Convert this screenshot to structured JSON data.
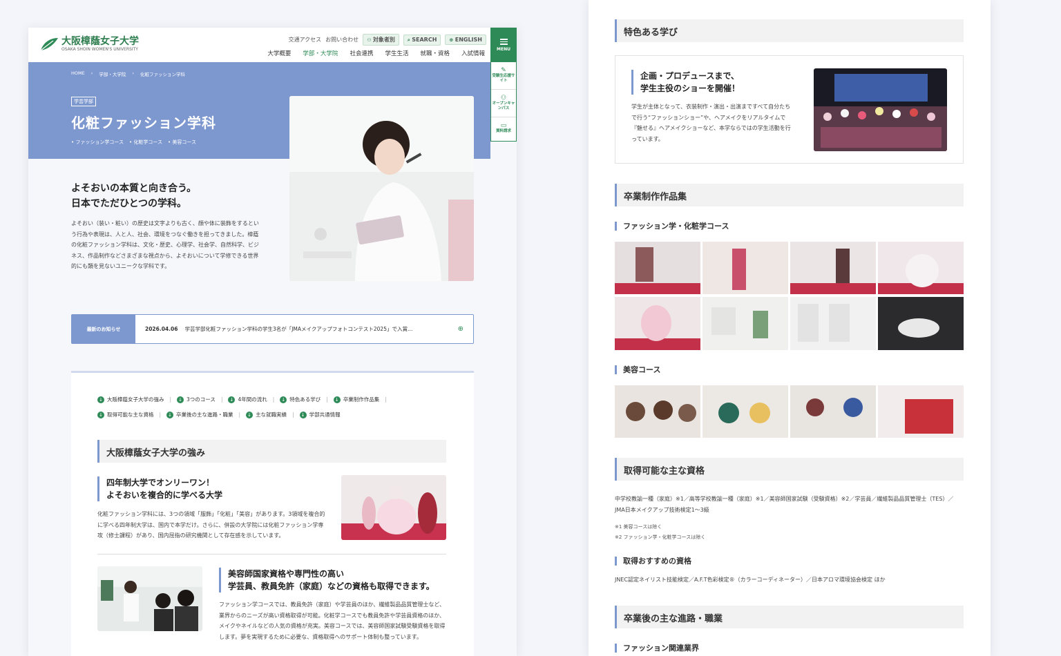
{
  "left": {
    "logo": {
      "jp": "大阪樟蔭女子大学",
      "en": "OSAKA SHOIN WOMEN'S UNIVERSITY"
    },
    "util": {
      "access": "交通アクセス",
      "contact": "お問い合わせ",
      "target": "対象者別",
      "search": "SEARCH",
      "english": "ENGLISH"
    },
    "nav": [
      "大学概要",
      "学部・大学院",
      "社会連携",
      "学生生活",
      "就職・資格",
      "入試情報"
    ],
    "menu": "MENU",
    "side": [
      "受験生応援サイト",
      "オープンキャンパス",
      "資料請求"
    ],
    "crumb": [
      "HOME",
      "学部・大学院",
      "化粧ファッション学科"
    ],
    "tag": "学芸学部",
    "title": "化粧ファッション学科",
    "courses": [
      "ファッション学コース",
      "化粧学コース",
      "美容コース"
    ],
    "lead1": "よそおいの本質と向き合う。",
    "lead2": "日本でただひとつの学科。",
    "lead_text": "よそおい（装い・粧い）の歴史は文字よりも古く、顔や体に装飾をするという行為や表現は、人と人、社会、環境をつなぐ働きを担ってきました。樟蔭の化粧ファッション学科は、文化・歴史、心理学、社会学、自然科学、ビジネス、作品制作などさまざまな視点から、よそおいについて学修できる世界的にも類を見ないユニークな学科です。",
    "news": {
      "label": "最新のお知らせ",
      "date": "2026.04.06",
      "text": "学芸学部化粧ファッション学科の学生3名が「JMAメイクアップフォトコンテスト2025」で入賞…"
    },
    "anchors": [
      "大阪樟蔭女子大学の強み",
      "3つのコース",
      "4年間の流れ",
      "特色ある学び",
      "卒業制作作品集",
      "取得可能な主な資格",
      "卒業後の主な進路・職業",
      "主な就職実績",
      "学部共通情報"
    ],
    "strength_title": "大阪樟蔭女子大学の強み",
    "s1_title1": "四年制大学でオンリーワン！",
    "s1_title2": "よそおいを複合的に学べる大学",
    "s1_text": "化粧ファッション学科には、3つの領域「服飾」「化粧」「美容」があります。3領域を複合的に学べる四年制大学は、国内で本学だけ。さらに、併設の大学院には化粧ファッション学専攻（修士課程）があり、国内屈指の研究機関として存在感を示しています。",
    "s2_title1": "美容師国家資格や専門性の高い",
    "s2_title2": "学芸員、教員免許（家庭）などの資格も取得できます。",
    "s2_text": "ファッション学コースでは、教員免許（家庭）や学芸員のほか、繊維製品品質管理士など、業界からのニーズが高い資格取得が可能。化粧学コースでも教員免許や学芸員資格のほか、メイクやネイルなどの人気の資格が充実。美容コースでは、美容師国家試験受験資格を取得します。夢を実現するために必要な、資格取得へのサポート体制も整っています。"
  },
  "right": {
    "feature_title": "特色ある学び",
    "feature_h1": "企画・プロデュースまで、",
    "feature_h2": "学生主役のショーを開催！",
    "feature_text": "学生が主体となって、衣装制作・演出・出演まですべて自分たちで行う“ファッションショー”や、ヘアメイクをリアルタイムで『魅せる』ヘアメイクショーなど、本学ならではの学生活動を行っています。",
    "works_title": "卒業制作作品集",
    "works_sub1": "ファッション学・化粧学コース",
    "works_sub2": "美容コース",
    "qual_title": "取得可能な主な資格",
    "qual_text": "中学校教諭一種（家庭）※1／高等学校教諭一種（家庭）※1／美容師国家試験（受験資格）※2／学芸員／繊維製品品質管理士（TES）／JMA日本メイクアップ技術検定1〜3級",
    "note1": "※1 美容コースは除く",
    "note2": "※2 ファッション学・化粧学コースは除く",
    "rec_title": "取得おすすめの資格",
    "rec_text": "JNEC認定ネイリスト技能検定／A.F.T色彩検定®（カラーコーディネーター）／日本アロマ環境協会検定 ほか",
    "career_title": "卒業後の主な進路・職業",
    "career_sub": "ファッション関連業界"
  },
  "colors": {
    "accent": "#7d97cf",
    "green": "#2e8b57"
  }
}
